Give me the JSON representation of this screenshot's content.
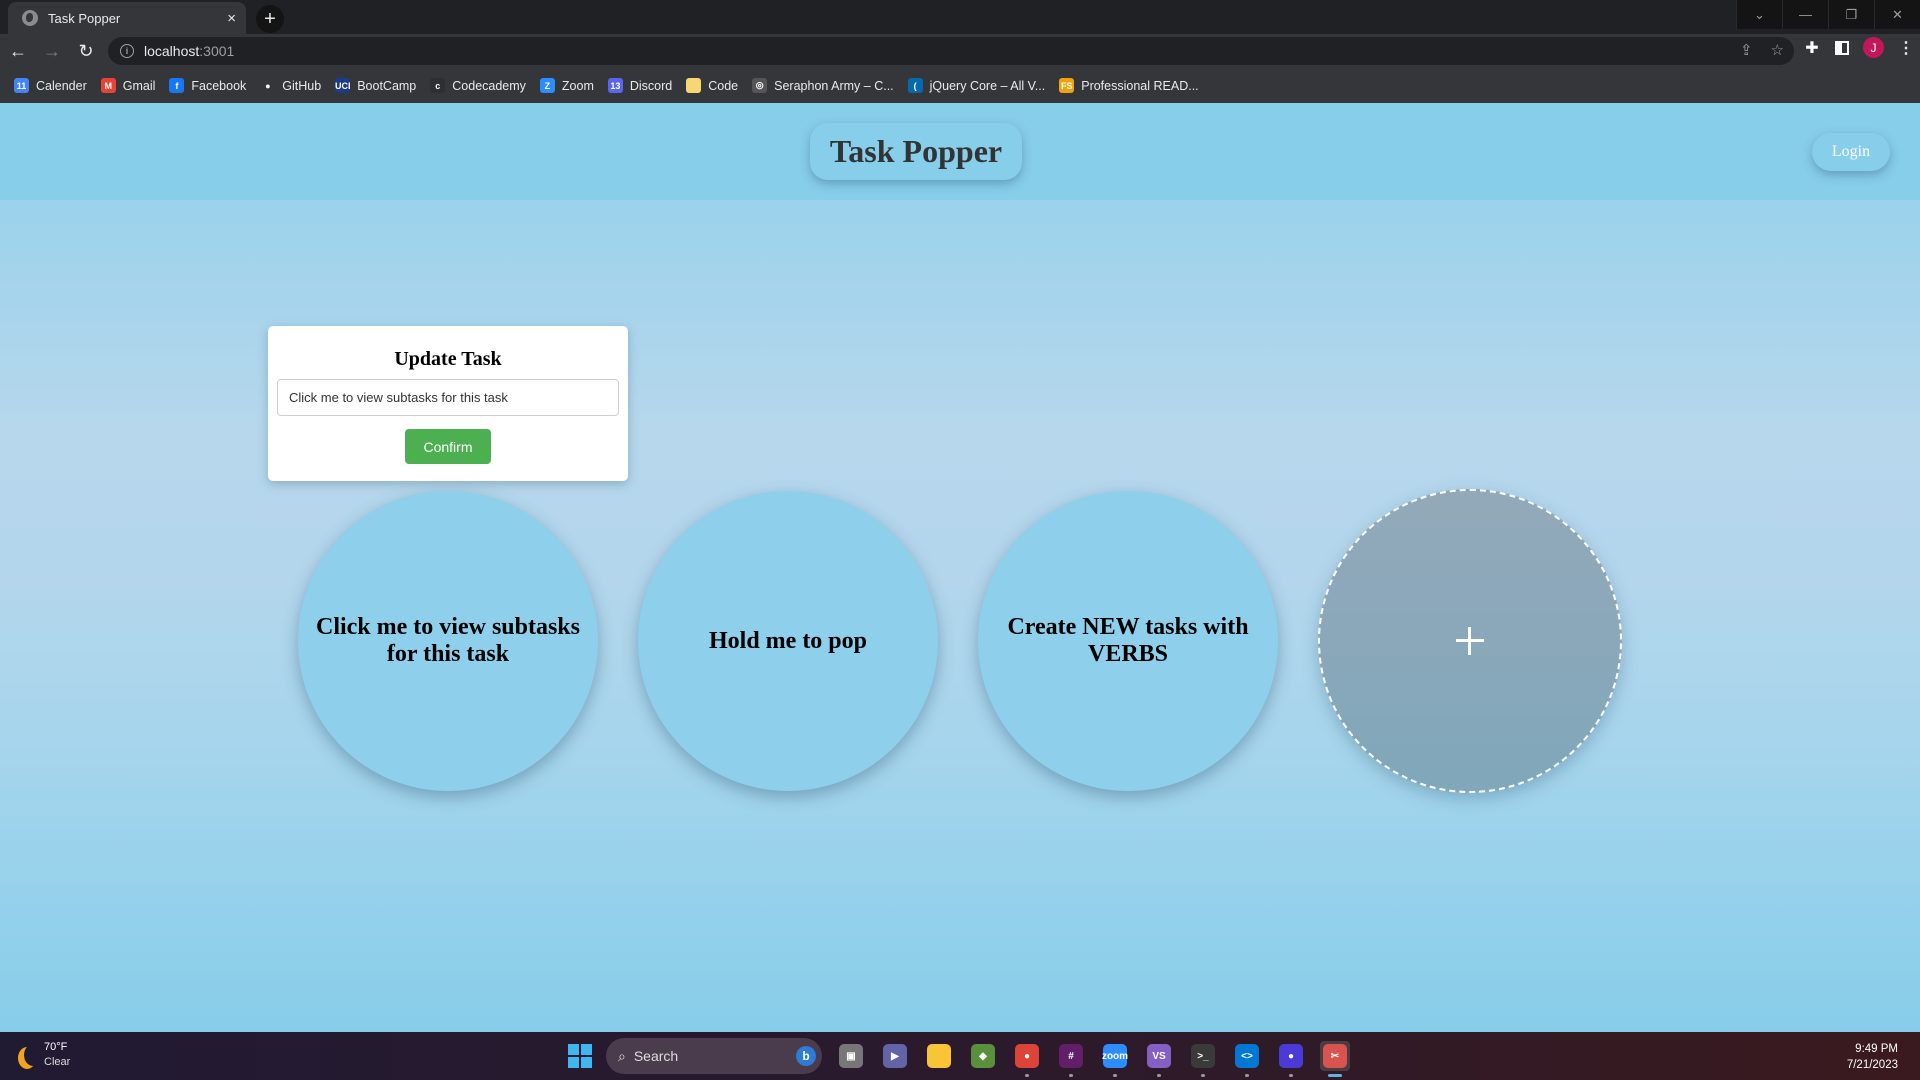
{
  "browser": {
    "tab_title": "Task Popper",
    "tab_close": "×",
    "new_tab": "+",
    "url_host": "localhost",
    "url_port": ":3001",
    "profile_initial": "J",
    "window_controls": [
      "⌄",
      "—",
      "❐",
      "✕"
    ],
    "bookmarks": [
      {
        "label": "Calender",
        "icon": "google-calendar-icon",
        "glyph": "11",
        "color": "#4285f4"
      },
      {
        "label": "Gmail",
        "icon": "gmail-icon",
        "glyph": "M",
        "color": "#ea4335"
      },
      {
        "label": "Facebook",
        "icon": "facebook-icon",
        "glyph": "f",
        "color": "#1877f2"
      },
      {
        "label": "GitHub",
        "icon": "github-icon",
        "glyph": "●",
        "color": "#35363a"
      },
      {
        "label": "BootCamp",
        "icon": "uci-icon",
        "glyph": "UCI",
        "color": "#1a3a8a"
      },
      {
        "label": "Codecademy",
        "icon": "codecademy-icon",
        "glyph": "c",
        "color": "#2d2f33"
      },
      {
        "label": "Zoom",
        "icon": "zoom-icon",
        "glyph": "Z",
        "color": "#2d8cff"
      },
      {
        "label": "Discord",
        "icon": "discord-icon",
        "glyph": "13",
        "color": "#5865f2"
      },
      {
        "label": "Code",
        "icon": "folder-icon",
        "glyph": "",
        "color": "#f7d774"
      },
      {
        "label": "Seraphon Army – C...",
        "icon": "seraphon-icon",
        "glyph": "◎",
        "color": "#555"
      },
      {
        "label": "jQuery Core – All V...",
        "icon": "jquery-icon",
        "glyph": "(",
        "color": "#0769ad"
      },
      {
        "label": "Professional READ...",
        "icon": "fs-icon",
        "glyph": "FS",
        "color": "#f0a30a"
      }
    ]
  },
  "app": {
    "title": "Task Popper",
    "login_label": "Login",
    "modal": {
      "title": "Update Task",
      "input_value": "Click me to view subtasks for this task",
      "confirm_label": "Confirm"
    },
    "tasks": [
      {
        "label": "Click me to view subtasks for this task"
      },
      {
        "label": "Hold me to pop"
      },
      {
        "label": "Create NEW tasks with VERBS"
      }
    ],
    "add_task_icon": "plus-icon",
    "colors": {
      "header": "#87ceeb",
      "bubble": "#8ecfeb",
      "confirm": "#4caf50",
      "title_text": "#333333"
    }
  },
  "taskbar": {
    "weather_temp": "70°F",
    "weather_cond": "Clear",
    "search_label": "Search",
    "time": "9:49 PM",
    "date": "7/21/2023",
    "apps": [
      {
        "name": "task-view",
        "glyph": "▣",
        "color": "#777"
      },
      {
        "name": "teams-chat",
        "glyph": "▶",
        "color": "#6264a7"
      },
      {
        "name": "file-explorer",
        "glyph": "",
        "color": "#f8c537"
      },
      {
        "name": "git-kraken",
        "glyph": "◆",
        "color": "#5a8f3c"
      },
      {
        "name": "chrome",
        "glyph": "●",
        "color": "#db4437"
      },
      {
        "name": "slack",
        "glyph": "#",
        "color": "#611f69"
      },
      {
        "name": "zoom",
        "glyph": "zoom",
        "color": "#2d8cff"
      },
      {
        "name": "visual-studio",
        "glyph": "VS",
        "color": "#865fc5"
      },
      {
        "name": "terminal",
        "glyph": ">_",
        "color": "#3a3a3a"
      },
      {
        "name": "vscode",
        "glyph": "<>",
        "color": "#0078d4"
      },
      {
        "name": "eclipse",
        "glyph": "●",
        "color": "#4b3bd6"
      },
      {
        "name": "snipping-tool",
        "glyph": "✂",
        "color": "#d9534f"
      }
    ]
  }
}
